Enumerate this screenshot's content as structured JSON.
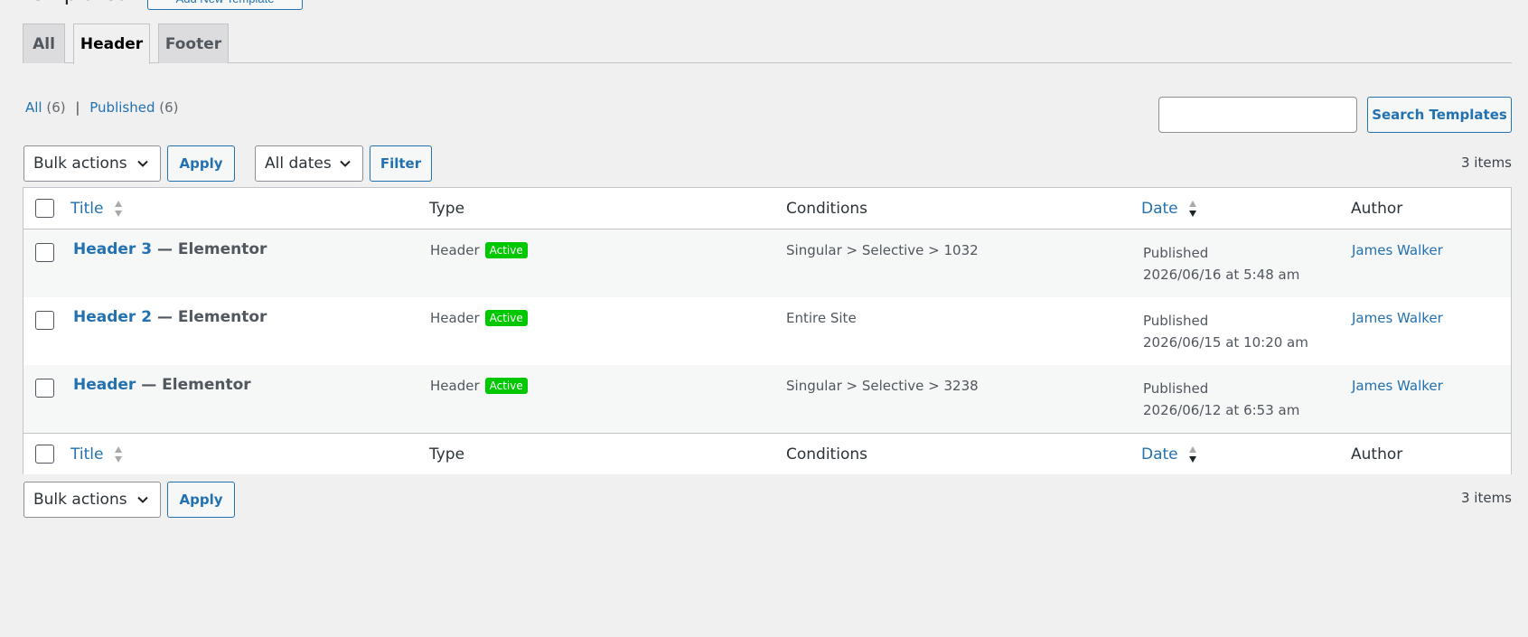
{
  "page": {
    "title": "Templates",
    "add_new_label": "Add New Template"
  },
  "tabs": [
    {
      "label": "All",
      "active": false
    },
    {
      "label": "Header",
      "active": true
    },
    {
      "label": "Footer",
      "active": false
    }
  ],
  "views": {
    "all_label": "All",
    "all_count": "(6)",
    "separator": "|",
    "published_label": "Published",
    "published_count": "(6)"
  },
  "search": {
    "value": "",
    "button_label": "Search Templates"
  },
  "tablenav": {
    "bulk_actions": "Bulk actions",
    "apply_label": "Apply",
    "dates": "All dates",
    "filter_label": "Filter",
    "items_count": "3 items"
  },
  "table": {
    "columns": {
      "title": "Title",
      "type": "Type",
      "conditions": "Conditions",
      "date": "Date",
      "author": "Author"
    },
    "rows": [
      {
        "title": "Header 3",
        "suffix": "— Elementor",
        "type": "Header",
        "badge": "Active",
        "conditions": "Singular > Selective > 1032",
        "status": "Published",
        "date": "2026/06/16 at 5:48 am",
        "author": "James Walker"
      },
      {
        "title": "Header 2",
        "suffix": "— Elementor",
        "type": "Header",
        "badge": "Active",
        "conditions": "Entire Site",
        "status": "Published",
        "date": "2026/06/15 at 10:20 am",
        "author": "James Walker"
      },
      {
        "title": "Header",
        "suffix": "— Elementor",
        "type": "Header",
        "badge": "Active",
        "conditions": "Singular > Selective > 3238",
        "status": "Published",
        "date": "2026/06/12 at 6:53 am",
        "author": "James Walker"
      }
    ]
  },
  "colors": {
    "link": "#2271b1",
    "active_badge": "#00c800",
    "background": "#f0f0f1"
  }
}
